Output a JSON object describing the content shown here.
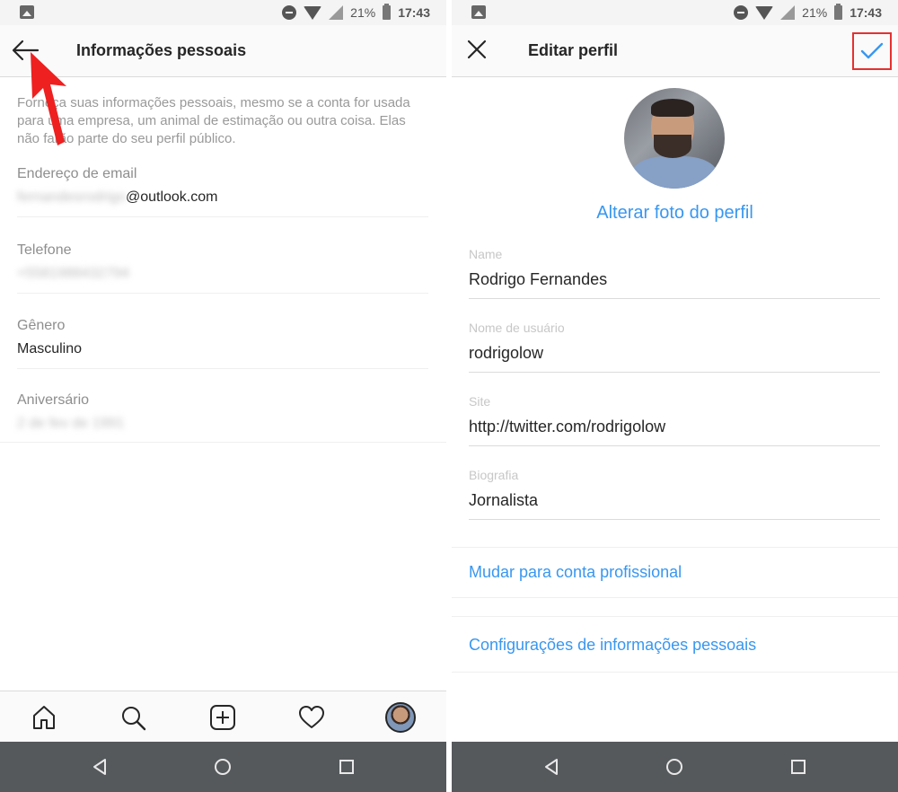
{
  "status_bar": {
    "battery": "21%",
    "time": "17:43"
  },
  "left_screen": {
    "title": "Informações pessoais",
    "description": "Forneça suas informações pessoais, mesmo se a conta for usada para uma empresa, um animal de estimação ou outra coisa. Elas não farão parte do seu perfil público.",
    "fields": [
      {
        "label": "Endereço de email",
        "value_blurred": "fernandesrodrigo",
        "value": "@outlook.com"
      },
      {
        "label": "Telefone",
        "value_blurred": "+5581988432794"
      },
      {
        "label": "Gênero",
        "value": "Masculino"
      },
      {
        "label": "Aniversário",
        "value_blurred": "2 de fev de 1991"
      }
    ],
    "bottom_nav": [
      "home-icon",
      "search-icon",
      "add-post-icon",
      "activity-heart-icon",
      "profile-avatar"
    ]
  },
  "right_screen": {
    "title": "Editar perfil",
    "change_photo_label": "Alterar foto do perfil",
    "fields": [
      {
        "label": "Name",
        "value": "Rodrigo Fernandes"
      },
      {
        "label": "Nome de usuário",
        "value": "rodrigolow"
      },
      {
        "label": "Site",
        "value": "http://twitter.com/rodrigolow"
      },
      {
        "label": "Biografia",
        "value": "Jornalista"
      }
    ],
    "links": {
      "professional": "Mudar para conta profissional",
      "personal_info": "Configurações de informações pessoais"
    }
  },
  "colors": {
    "link_blue": "#3897f0",
    "highlight_red": "#e53030",
    "nav_gray": "#55595c"
  }
}
